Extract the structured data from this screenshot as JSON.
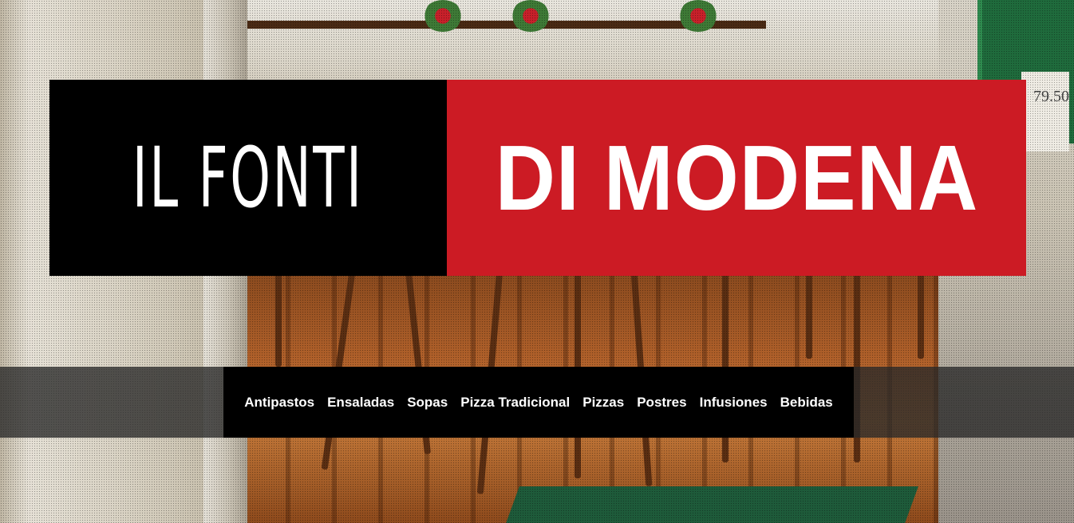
{
  "banner": {
    "left_text": "IL FONTI",
    "right_text": "DI MODENA"
  },
  "background": {
    "sign_text": "79.50"
  },
  "nav": {
    "items": [
      {
        "label": "Antipastos"
      },
      {
        "label": "Ensaladas"
      },
      {
        "label": "Sopas"
      },
      {
        "label": "Pizza Tradicional"
      },
      {
        "label": "Pizzas"
      },
      {
        "label": "Postres"
      },
      {
        "label": "Infusiones"
      },
      {
        "label": "Bebidas"
      }
    ]
  },
  "colors": {
    "banner_left_bg": "#000000",
    "banner_right_bg": "#cc1b24",
    "nav_bg": "#000000",
    "nav_text": "#ffffff"
  }
}
